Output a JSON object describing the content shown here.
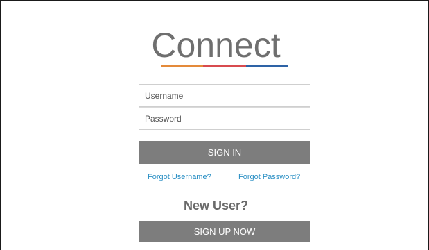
{
  "app": {
    "logo_text": "Connect",
    "logo_underline_colors": [
      "#e48a3a",
      "#d84b4f",
      "#2e63a6"
    ]
  },
  "login_form": {
    "username_placeholder": "Username",
    "password_placeholder": "Password",
    "sign_in_label": "SIGN IN",
    "button_color": "#7d7d7d"
  },
  "links": {
    "forgot_username": "Forgot Username?",
    "forgot_password": "Forgot Password?",
    "link_color": "#2a8fc4"
  },
  "signup": {
    "heading": "New User?",
    "sign_up_label": "SIGN UP NOW"
  }
}
